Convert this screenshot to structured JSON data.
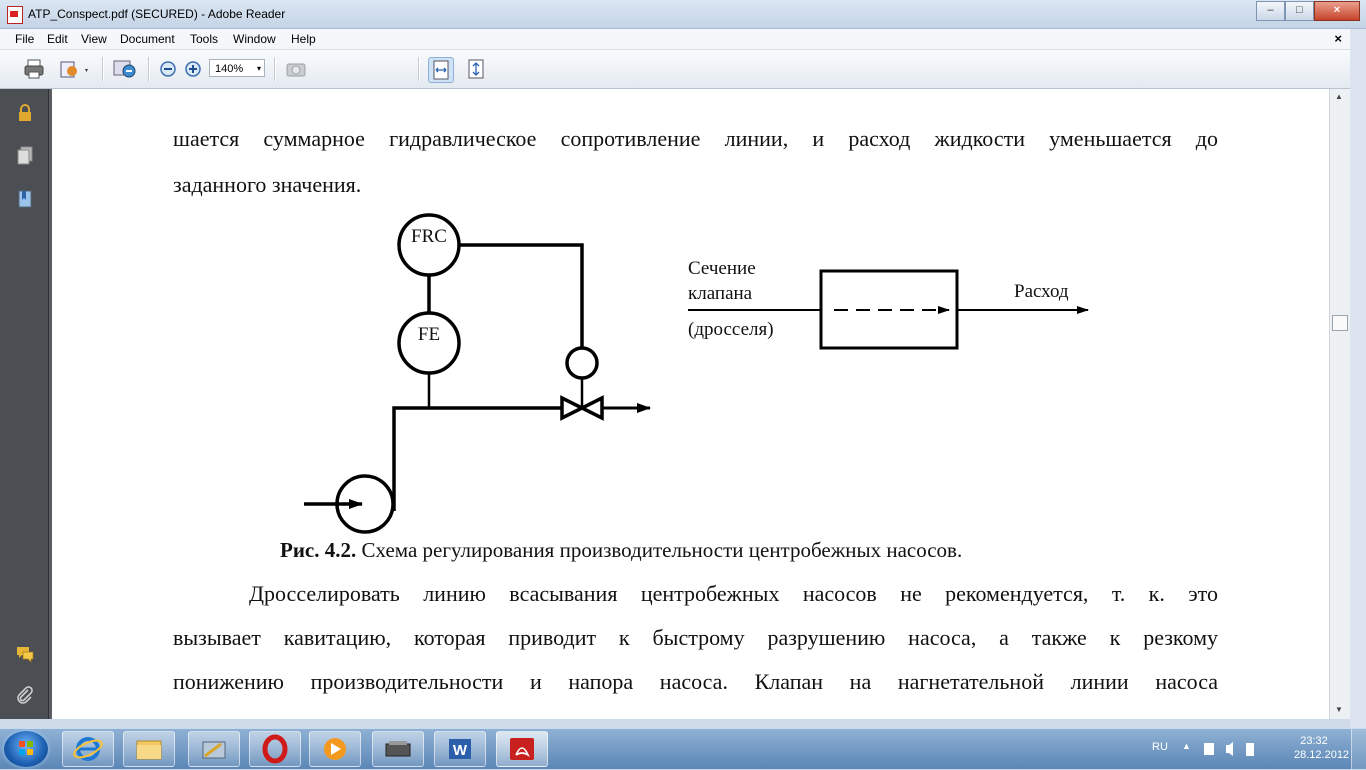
{
  "window": {
    "title": "ATP_Conspect.pdf (SECURED) - Adobe Reader",
    "close_glyph": "×",
    "min_glyph": "‒",
    "max_glyph": "□"
  },
  "menu": {
    "items": [
      "File",
      "Edit",
      "View",
      "Document",
      "Tools",
      "Window",
      "Help"
    ],
    "close_glyph": "×"
  },
  "toolbar": {
    "zoom": "140%",
    "zoom_arrow": "▾"
  },
  "document": {
    "line1": "шается суммарное гидравлическое сопротивление линии, и расход жидкости уменьшается до",
    "line2": "заданного значения.",
    "diagram": {
      "frc_label": "FRC",
      "fe_label": "FE",
      "section_line1": "Сечение",
      "section_line2": "клапана",
      "section_line3": "(дросселя)",
      "flow_label": "Расход"
    },
    "caption_bold": "Рис. 4.2.",
    "caption_text": " Схема регулирования производительности центробежных насосов.",
    "para2_line1": "Дросселировать линию всасывания центробежных насосов не рекомендуется, т. к. это",
    "para2_line2": "вызывает кавитацию, которая приводит к быстрому разрушению насоса, а также к резкому",
    "para2_line3": "понижению производительности и напора насоса. Клапан на нагнетательной линии насоса"
  },
  "taskbar": {
    "language": "RU",
    "time": "23:32",
    "date": "28.12.2012"
  },
  "colors": {
    "accent": "#c7432b",
    "taskbar": "#5b86b6"
  }
}
